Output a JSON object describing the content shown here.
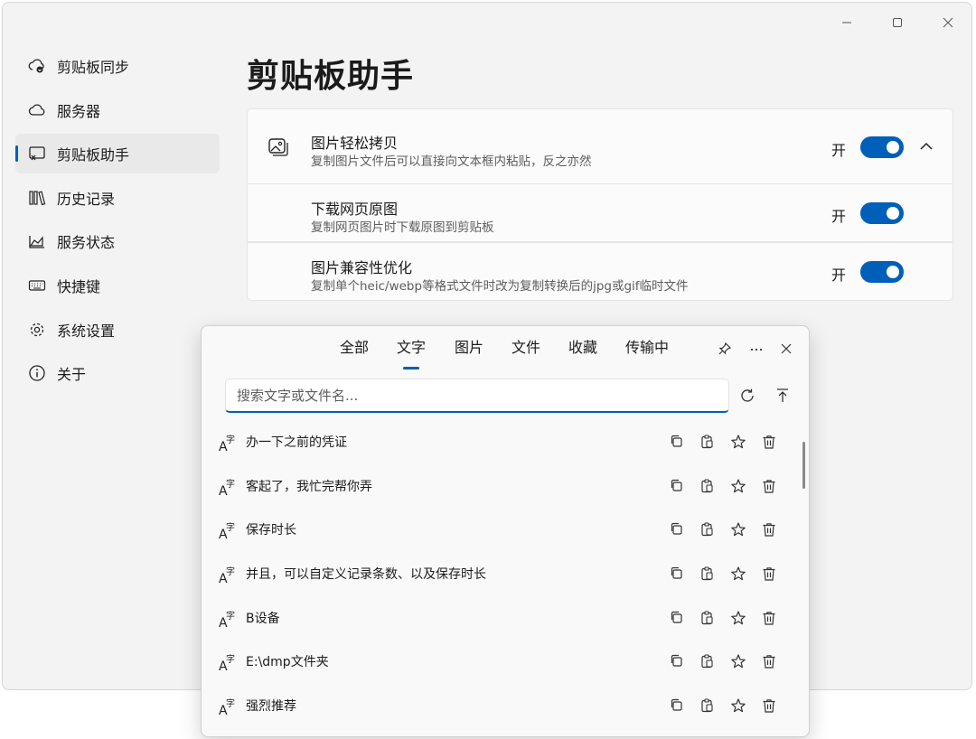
{
  "app": {
    "window_controls": [
      "minimize",
      "maximize",
      "close"
    ]
  },
  "sidebar": {
    "items": [
      {
        "label": "剪贴板同步",
        "icon": "cloud-sync-icon",
        "active": false
      },
      {
        "label": "服务器",
        "icon": "cloud-icon",
        "active": false
      },
      {
        "label": "剪贴板助手",
        "icon": "clipboard-assistant-icon",
        "active": true
      },
      {
        "label": "历史记录",
        "icon": "library-icon",
        "active": false
      },
      {
        "label": "服务状态",
        "icon": "chart-area-icon",
        "active": false
      },
      {
        "label": "快捷键",
        "icon": "keyboard-icon",
        "active": false
      },
      {
        "label": "系统设置",
        "icon": "gear-icon",
        "active": false
      },
      {
        "label": "关于",
        "icon": "info-icon",
        "active": false
      }
    ]
  },
  "main": {
    "title": "剪贴板助手",
    "settings": [
      {
        "title": "图片轻松拷贝",
        "desc": "复制图片文件后可以直接向文本框内粘贴，反之亦然",
        "state": "开",
        "on": true
      },
      {
        "title": "下载网页原图",
        "desc": "复制网页图片时下载原图到剪贴板",
        "state": "开",
        "on": true
      },
      {
        "title": "图片兼容性优化",
        "desc": "复制单个heic/webp等格式文件时改为复制转换后的jpg或gif临时文件",
        "state": "开",
        "on": true
      }
    ]
  },
  "popup": {
    "tabs": [
      "全部",
      "文字",
      "图片",
      "文件",
      "收藏",
      "传输中"
    ],
    "active_tab": 1,
    "search_placeholder": "搜索文字或文件名...",
    "items": [
      "办一下之前的凭证",
      "客起了，我忙完帮你弄",
      "保存时长",
      "并且，可以自定义记录条数、以及保存时长",
      "B设备",
      "E:\\dmp文件夹",
      "强烈推荐"
    ]
  },
  "colors": {
    "accent": "#005fb8",
    "window_bg": "#f3f3f3",
    "card_bg": "#fbfbfb"
  }
}
